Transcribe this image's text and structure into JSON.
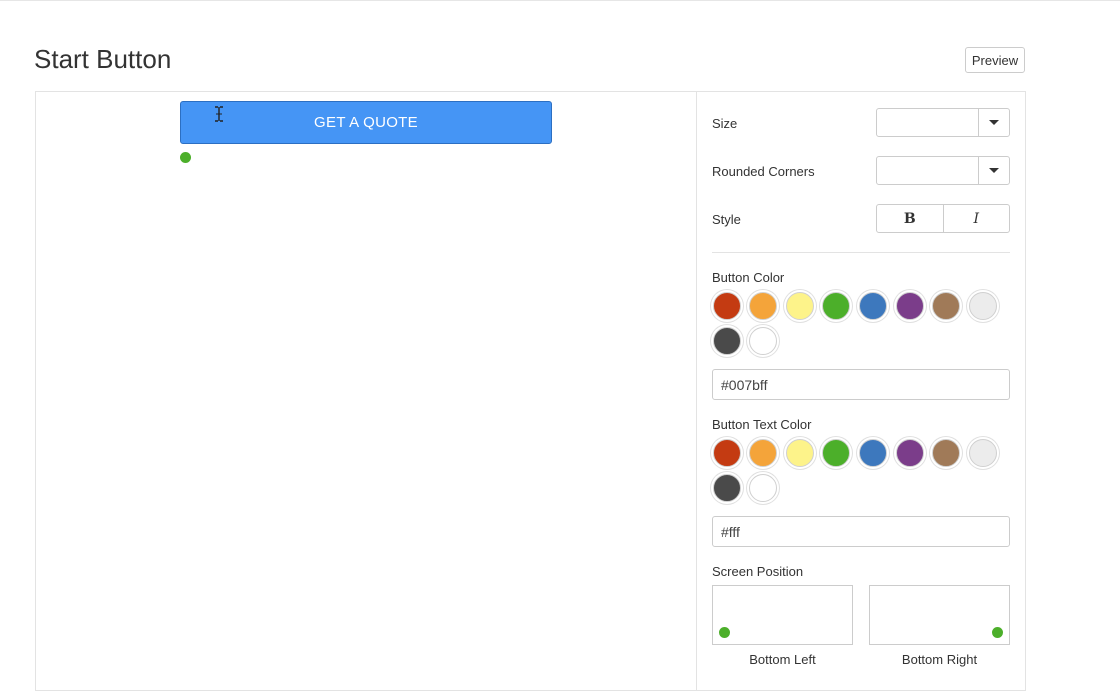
{
  "header": {
    "title": "Start Button",
    "preview_label": "Preview"
  },
  "canvas": {
    "button_label": "GET A QUOTE",
    "button_color": "#4595f5",
    "anchor_dot_color": "#4caf2a"
  },
  "settings": {
    "size_label": "Size",
    "size_value": "",
    "corners_label": "Rounded Corners",
    "corners_value": "",
    "style_label": "Style",
    "style_bold": "B",
    "style_italic": "I",
    "button_color_label": "Button Color",
    "button_color_value": "#007bff",
    "text_color_label": "Button Text Color",
    "text_color_value": "#fff",
    "position_label": "Screen Position",
    "position_left_label": "Bottom Left",
    "position_right_label": "Bottom Right"
  },
  "palette": [
    "#c43b12",
    "#f4a43a",
    "#fdf38a",
    "#4caf2a",
    "#3d78bd",
    "#7b3d8a",
    "#a07a58",
    "#ececec",
    "#4a4a4a",
    "#ffffff"
  ]
}
